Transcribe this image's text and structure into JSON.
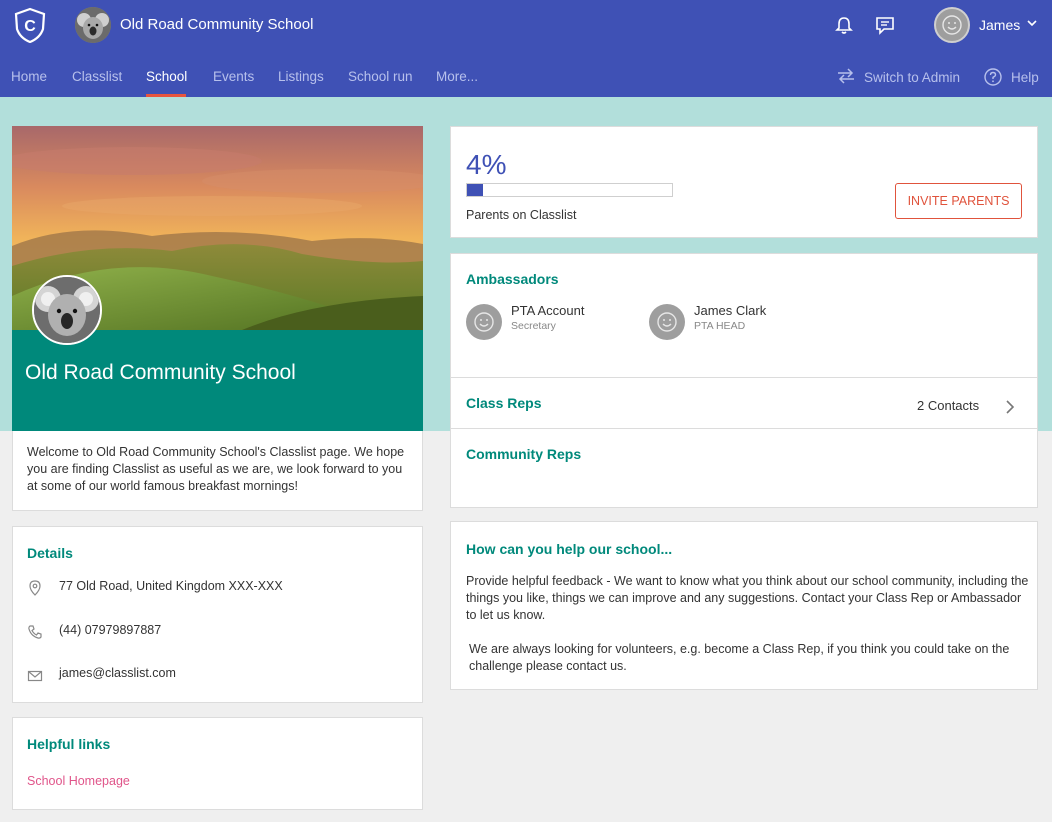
{
  "header": {
    "logo_letter": "C",
    "school_name": "Old Road Community School",
    "user_name": "James"
  },
  "nav": {
    "items": [
      "Home",
      "Classlist",
      "School",
      "Events",
      "Listings",
      "School run",
      "More..."
    ],
    "active": "School",
    "switch_label": "Switch to Admin",
    "help_label": "Help"
  },
  "hero": {
    "title": "Old Road Community School"
  },
  "welcome": {
    "text": "Welcome to Old Road Community School's Classlist page. We hope you are finding Classlist as useful as we are, we look forward to you at some of our world famous breakfast mornings!"
  },
  "details": {
    "heading": "Details",
    "address": "77 Old Road, United Kingdom XXX-XXX",
    "phone": "(44) 07979897887",
    "email": "james@classlist.com"
  },
  "links": {
    "heading": "Helpful links",
    "items": [
      "School Homepage"
    ]
  },
  "progress": {
    "percent_label": "4%",
    "fraction": 0.04,
    "caption": "Parents on Classlist",
    "invite_label": "INVITE PARENTS"
  },
  "ambassadors": {
    "heading": "Ambassadors",
    "people": [
      {
        "name": "PTA Account",
        "role": "Secretary"
      },
      {
        "name": "James Clark",
        "role": "PTA HEAD"
      }
    ],
    "class_reps_label": "Class Reps",
    "contacts_label": "2 Contacts",
    "community_reps_label": "Community Reps"
  },
  "help": {
    "heading": "How can you help our school...",
    "para1": "Provide helpful feedback - We want to know what you think about our school community, including the things you like, things we can improve and any suggestions. Contact your Class Rep or Ambassador to let us know.",
    "para2": "We are always looking for volunteers, e.g. become a Class Rep, if you think you could take on the challenge please contact us."
  },
  "colors": {
    "header": "#3f51b5",
    "accent_teal": "#00897b",
    "accent_orange": "#e0533c",
    "link_pink": "#e0558a"
  }
}
